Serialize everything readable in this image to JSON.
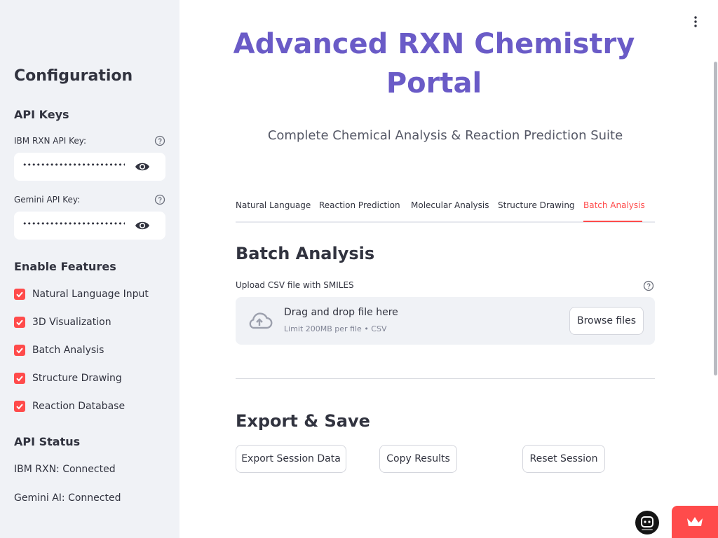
{
  "sidebar": {
    "title": "Configuration",
    "api_keys_heading": "API Keys",
    "ibm_key_label": "IBM RXN API Key:",
    "ibm_key_value": "••••••••••••••••••••••••••••••",
    "gemini_key_label": "Gemini API Key:",
    "gemini_key_value": "••••••••••••••••••••••••••••••",
    "features_heading": "Enable Features",
    "features": [
      {
        "label": "Natural Language Input",
        "checked": true
      },
      {
        "label": "3D Visualization",
        "checked": true
      },
      {
        "label": "Batch Analysis",
        "checked": true
      },
      {
        "label": "Structure Drawing",
        "checked": true
      },
      {
        "label": "Reaction Database",
        "checked": true
      }
    ],
    "status_heading": "API Status",
    "status_ibm": "IBM RXN: Connected",
    "status_gemini": "Gemini AI: Connected"
  },
  "header": {
    "title_line1": "Advanced RXN Chemistry",
    "title_line2": "Portal",
    "subtitle": "Complete Chemical Analysis & Reaction Prediction Suite"
  },
  "tabs": [
    {
      "label": "Natural Language",
      "active": false
    },
    {
      "label": "Reaction Prediction",
      "active": false
    },
    {
      "label": "Molecular Analysis",
      "active": false
    },
    {
      "label": "Structure Drawing",
      "active": false
    },
    {
      "label": "Batch Analysis",
      "active": true
    }
  ],
  "batch": {
    "heading": "Batch Analysis",
    "upload_label": "Upload CSV file with SMILES",
    "drop_title": "Drag and drop file here",
    "drop_sub": "Limit 200MB per file • CSV",
    "browse_label": "Browse files"
  },
  "export": {
    "heading": "Export & Save",
    "export_label": "Export Session Data",
    "copy_label": "Copy Results",
    "reset_label": "Reset Session"
  },
  "colors": {
    "accent": "#ff4b4b",
    "title": "#6a5bc7",
    "sidebar_bg": "#f0f2f6"
  }
}
